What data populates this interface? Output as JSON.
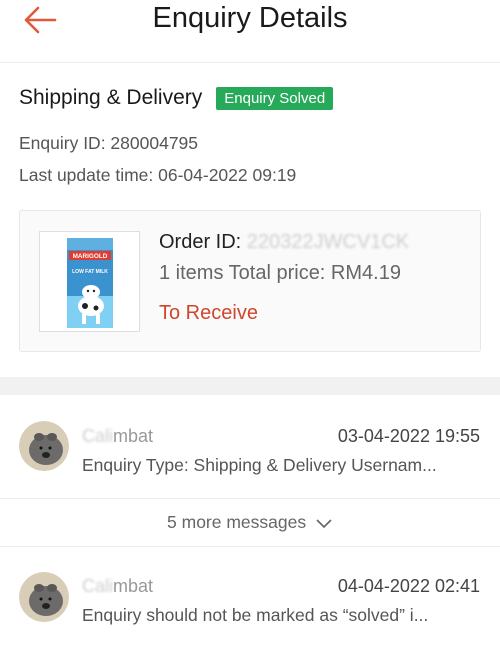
{
  "header": {
    "title": "Enquiry Details",
    "back_icon": "arrow-left-icon",
    "accent": "#e05a3a"
  },
  "enquiry": {
    "topic": "Shipping & Delivery",
    "status_badge": "Enquiry Solved",
    "status_color": "#26aa5a",
    "id_text": "Enquiry ID: 280004795",
    "last_update_text": "Last update time: 06-04-2022 09:19"
  },
  "order": {
    "id_label": "Order ID: ",
    "id_masked": "220322JWCV1CK",
    "items_text": "1 items  Total price: RM4.19",
    "status": "To Receive",
    "status_color": "#d0462c",
    "product_brand": "MARIGOLD",
    "product_label": "LOW FAT MILK"
  },
  "messages": [
    {
      "name_masked": "Cali",
      "name_visible": "mbat",
      "time": "03-04-2022 19:55",
      "preview": "Enquiry Type: Shipping & Delivery Usernam..."
    },
    {
      "name_masked": "Cali",
      "name_visible": "mbat",
      "time": "04-04-2022 02:41",
      "preview": "Enquiry should not be marked as “solved” i..."
    }
  ],
  "more_messages": "5 more messages"
}
